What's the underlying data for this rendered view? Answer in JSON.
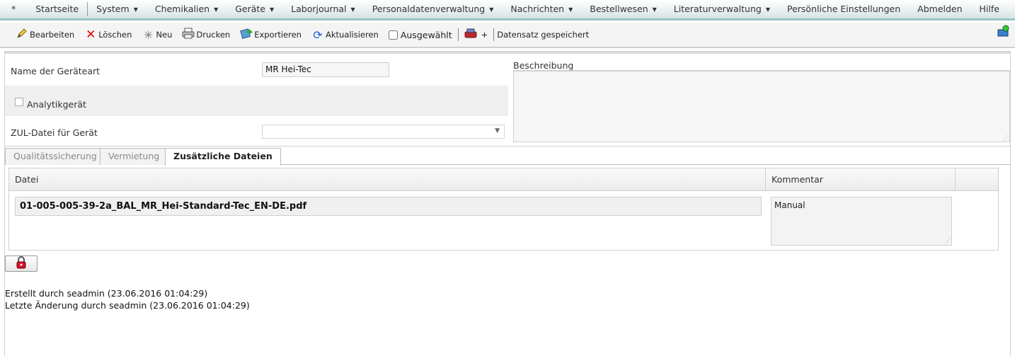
{
  "menu": {
    "home_star": "*",
    "items": [
      {
        "label": "Startseite",
        "dropdown": false
      },
      {
        "label": "System",
        "dropdown": true
      },
      {
        "label": "Chemikalien",
        "dropdown": true
      },
      {
        "label": "Geräte",
        "dropdown": true
      },
      {
        "label": "Laborjournal",
        "dropdown": true
      },
      {
        "label": "Personaldatenverwaltung",
        "dropdown": true
      },
      {
        "label": "Nachrichten",
        "dropdown": true
      },
      {
        "label": "Bestellwesen",
        "dropdown": true
      },
      {
        "label": "Literaturverwaltung",
        "dropdown": true
      },
      {
        "label": "Persönliche Einstellungen",
        "dropdown": false
      },
      {
        "label": "Abmelden",
        "dropdown": false
      },
      {
        "label": "Hilfe",
        "dropdown": false
      }
    ]
  },
  "toolbar": {
    "edit": "Bearbeiten",
    "delete": "Löschen",
    "new": "Neu",
    "print": "Drucken",
    "export": "Exportieren",
    "refresh": "Aktualisieren",
    "selected": "Ausgewählt",
    "plus": "+",
    "status": "Datensatz gespeichert"
  },
  "form": {
    "name_label": "Name der Geräteart",
    "name_value": "MR Hei-Tec",
    "analytic_label": "Analytikgerät",
    "zul_label": "ZUL-Datei für Gerät",
    "zul_value": "",
    "description_label": "Beschreibung",
    "description_value": ""
  },
  "tabs": [
    {
      "label": "Qualitätssicherung",
      "active": false
    },
    {
      "label": "Vermietung",
      "active": false
    },
    {
      "label": "Zusätzliche Dateien",
      "active": true
    }
  ],
  "files_table": {
    "headers": [
      "Datei",
      "Kommentar",
      ""
    ],
    "rows": [
      {
        "file": "01-005-005-39-2a_BAL_MR_Hei-Standard-Tec_EN-DE.pdf",
        "comment": "Manual"
      }
    ]
  },
  "footer": {
    "created": "Erstellt durch seadmin (23.06.2016 01:04:29)",
    "modified": "Letzte Änderung durch seadmin (23.06.2016 01:04:29)"
  },
  "colors": {
    "menu_accent": "#9cc6c6",
    "delete_icon": "#e00000",
    "lock_icon": "#d0102a"
  }
}
